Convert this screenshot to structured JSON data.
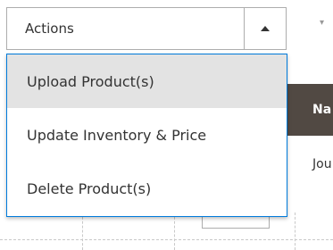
{
  "actions": {
    "label": "Actions",
    "items": [
      {
        "label": "Upload Product(s)",
        "highlighted": true
      },
      {
        "label": "Update Inventory & Price",
        "highlighted": false
      },
      {
        "label": "Delete Product(s)",
        "highlighted": false
      }
    ]
  },
  "background": {
    "column_header": "Na",
    "cell_text": "Jou"
  },
  "colors": {
    "header_bg": "#514943",
    "focus_border": "#007bdb",
    "highlight_bg": "#e3e3e3"
  }
}
